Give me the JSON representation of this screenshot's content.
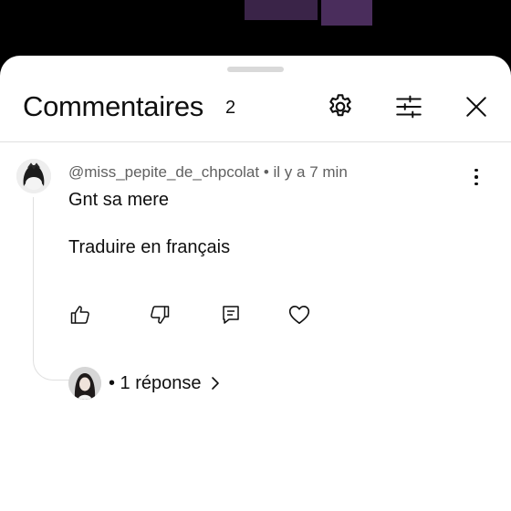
{
  "panel": {
    "title": "Commentaires",
    "count": "2"
  },
  "comment": {
    "author": "@miss_pepite_de_chpcolat",
    "separator": "•",
    "time": "il y a 7 min",
    "text": "Gnt sa mere",
    "translate_label": "Traduire en français"
  },
  "replies": {
    "label": "• 1 réponse"
  },
  "icons": {
    "settings": "gear-icon",
    "filter": "sliders-icon",
    "close": "close-icon",
    "more": "more-vertical-icon",
    "like": "thumb-up-icon",
    "dislike": "thumb-down-icon",
    "reply": "reply-comment-icon",
    "heart": "heart-icon",
    "chevron": "chevron-right-icon"
  }
}
